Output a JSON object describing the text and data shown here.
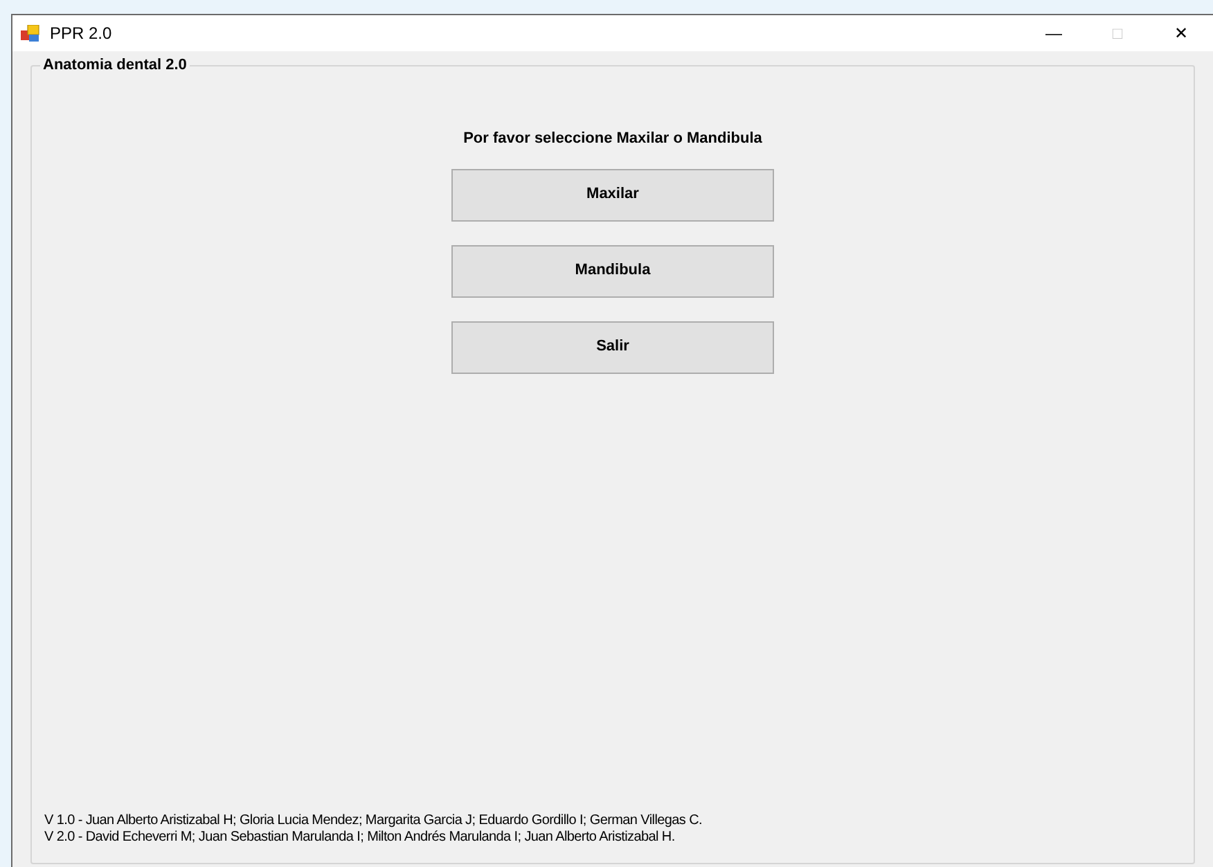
{
  "window": {
    "title": "PPR 2.0",
    "controls": [
      "—",
      "□",
      "✕"
    ]
  },
  "group": {
    "title": "Anatomia dental 2.0"
  },
  "prompt": "Por favor seleccione Maxilar o Mandibula",
  "buttons": [
    "Maxilar",
    "Mandibula",
    "Salir"
  ],
  "credits": [
    "V 1.0 - Juan Alberto Aristizabal H; Gloria Lucia Mendez; Margarita Garcia J; Eduardo Gordillo I; German Villegas C.",
    "V 2.0 - David Echeverri M; Juan Sebastian Marulanda I; Milton Andrés Marulanda I; Juan Alberto Aristizabal H."
  ]
}
